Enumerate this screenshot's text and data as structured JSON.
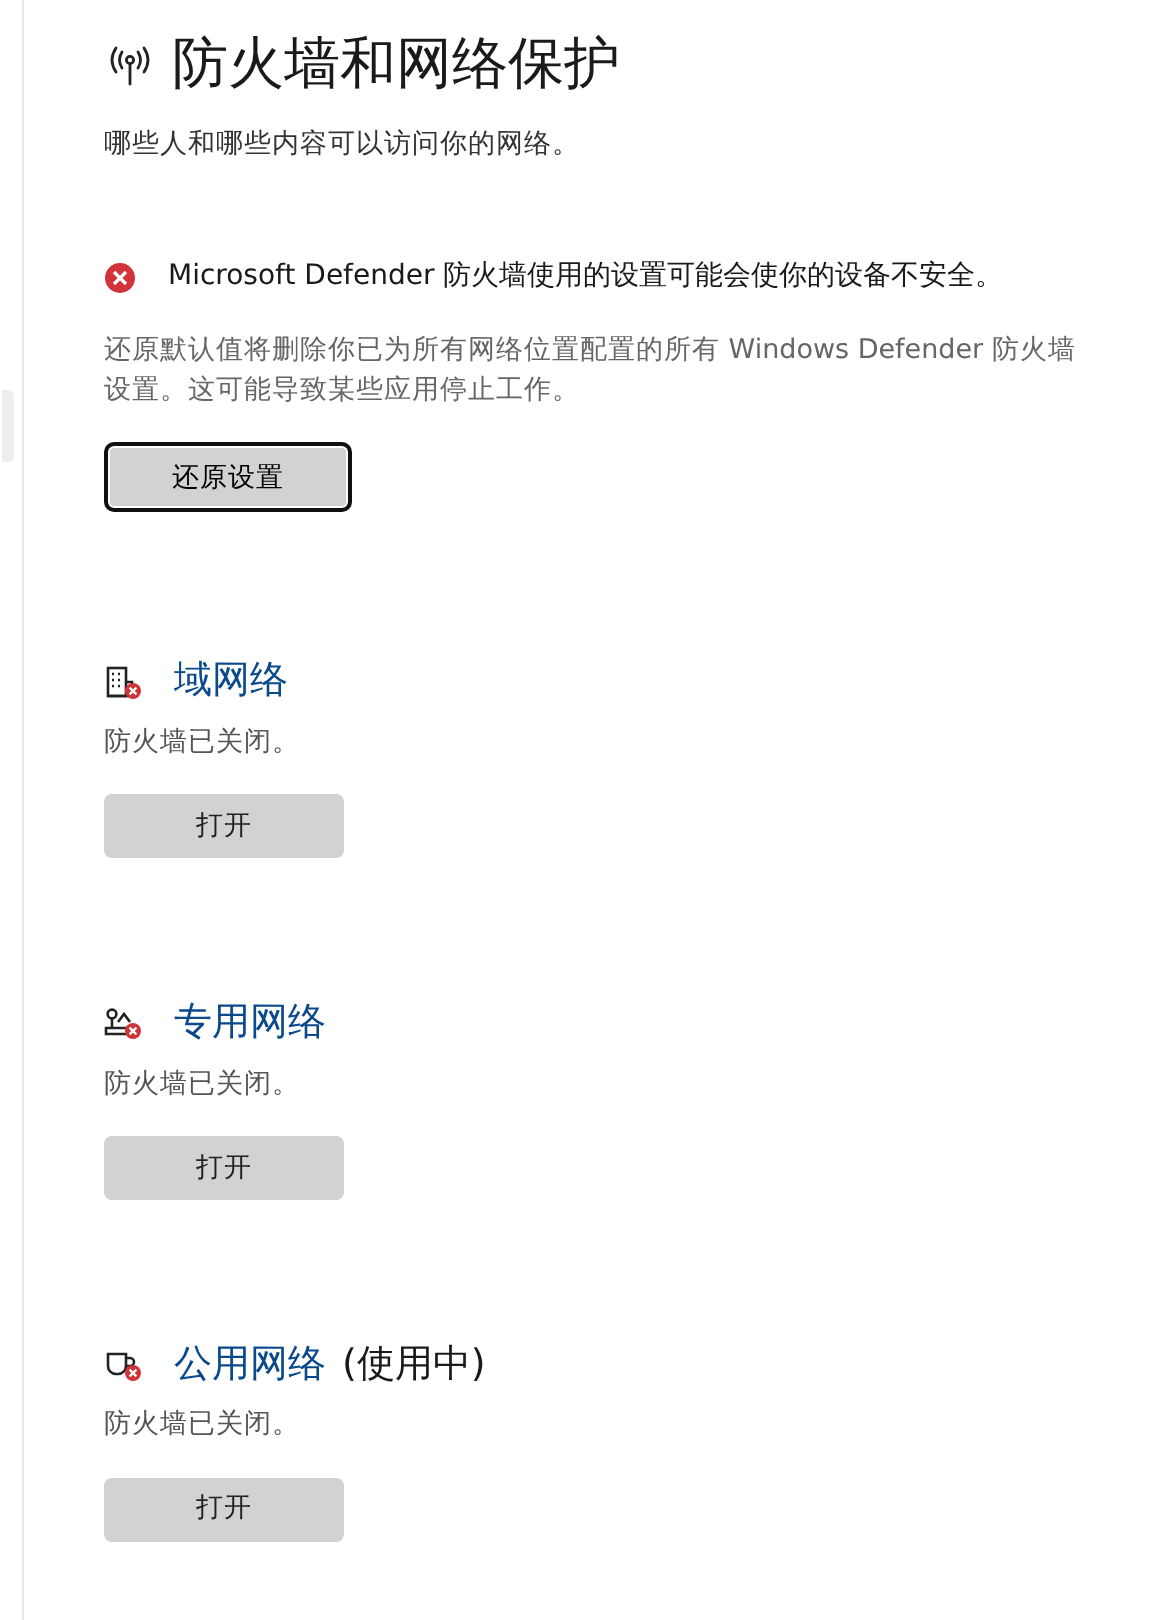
{
  "page": {
    "title": "防火墙和网络保护",
    "subtitle": "哪些人和哪些内容可以访问你的网络。"
  },
  "alert": {
    "message": "Microsoft Defender 防火墙使用的设置可能会使你的设备不安全。",
    "description": "还原默认值将删除你已为所有网络位置配置的所有 Windows Defender 防火墙设置。这可能导致某些应用停止工作。",
    "button": {
      "label": "还原设置",
      "focused": true
    }
  },
  "networks": [
    {
      "kind": "domain",
      "name": "域网络",
      "status": "防火墙已关闭。",
      "button": "打开"
    },
    {
      "kind": "private",
      "name": "专用网络",
      "status": "防火墙已关闭。",
      "button": "打开"
    },
    {
      "kind": "public",
      "name": "公用网络",
      "suffix": "(使用中)",
      "status": "防火墙已关闭。",
      "button": "打开"
    }
  ]
}
